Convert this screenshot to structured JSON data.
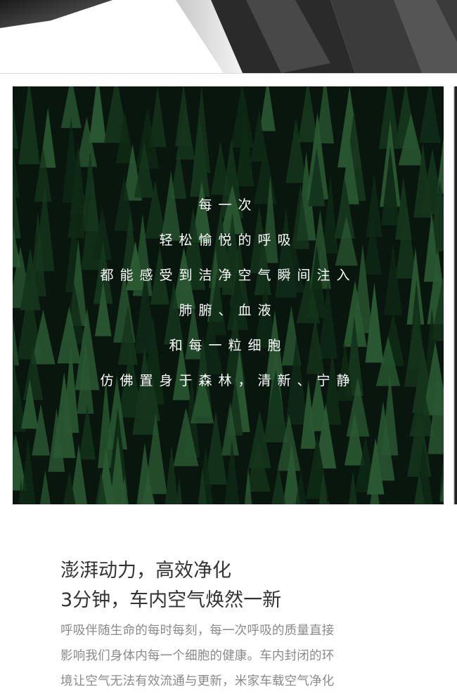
{
  "poem": {
    "lines": [
      "每一次",
      "轻松愉悦的呼吸",
      "都能感受到洁净空气瞬间注入",
      "肺腑、血液",
      "和每一粒细胞",
      "仿佛置身于森林，清新、宁静"
    ]
  },
  "headline": {
    "line1": "澎湃动力，高效净化",
    "line2": "3分钟，车内空气焕然一新"
  },
  "body": {
    "lines": [
      "呼吸伴随生命的每时每刻，每一次呼吸的质量直接",
      "影响我们身体内每一个细胞的健康。车内封闭的环",
      "境让空气无法有效流通与更新，米家车载空气净化"
    ]
  },
  "colors": {
    "forest_dark": "#0c1f12",
    "forest_mid": "#1d4a28",
    "forest_light": "#3a7a45",
    "headline": "#333333",
    "body": "#8a8a8a"
  }
}
